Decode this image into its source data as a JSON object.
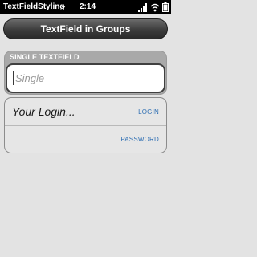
{
  "status_bar": {
    "app_title": "TextFieldStyling",
    "time": "2:14",
    "icons": [
      "chevron-down-icon",
      "signal-icon",
      "wifi-icon",
      "battery-icon"
    ]
  },
  "header": {
    "title": "TextField in Groups"
  },
  "group_single": {
    "title": "SINGLE TEXTFIELD",
    "input_placeholder": "Single"
  },
  "group_login": {
    "login_value": "Your Login...",
    "login_label": "LOGIN",
    "password_label": "PASSWORD"
  },
  "colors": {
    "status_bar_bg": "#000000",
    "header_bg": "#3c3c3c",
    "page_bg": "#e3e3e3",
    "group_header_bg": "#a9a9a9",
    "label_blue": "#2f6fb3"
  }
}
